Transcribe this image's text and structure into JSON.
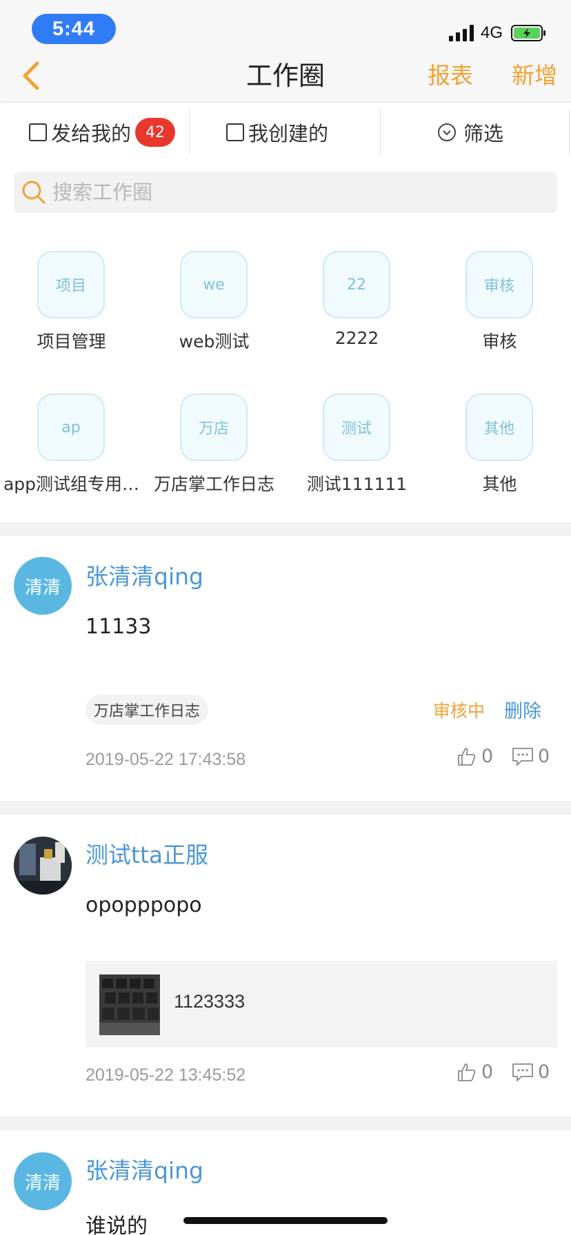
{
  "status_bar": {
    "time": "5:44",
    "network": "4G"
  },
  "nav": {
    "title": "工作圈",
    "report": "报表",
    "add": "新增"
  },
  "filters": {
    "sent_to_me": "发给我的",
    "sent_to_me_count": "42",
    "created_by_me": "我创建的",
    "filter": "筛选"
  },
  "search": {
    "placeholder": "搜索工作圈"
  },
  "categories": [
    {
      "icon_text": "项目",
      "label": "项目管理"
    },
    {
      "icon_text": "we",
      "label": "web测试"
    },
    {
      "icon_text": "22",
      "label": "2222"
    },
    {
      "icon_text": "审核",
      "label": "审核"
    },
    {
      "icon_text": "ap",
      "label": "app测试组专用…"
    },
    {
      "icon_text": "万店",
      "label": "万店掌工作日志"
    },
    {
      "icon_text": "测试",
      "label": "测试111111"
    },
    {
      "icon_text": "其他",
      "label": "其他"
    }
  ],
  "posts": [
    {
      "avatar_text": "清清",
      "author": "张清清qing",
      "content": "11133",
      "tag": "万店掌工作日志",
      "status": "审核中",
      "delete": "删除",
      "time": "2019-05-22 17:43:58",
      "likes": "0",
      "comments": "0"
    },
    {
      "author": "测试tta正服",
      "content": "opopppopo",
      "attachment_text": "1123333",
      "time": "2019-05-22 13:45:52",
      "likes": "0",
      "comments": "0"
    },
    {
      "avatar_text": "清清",
      "author": "张清清qing",
      "content": "谁说的"
    }
  ],
  "colors": {
    "accent": "#f0a232",
    "link": "#4a97d6",
    "badge": "#e8382c",
    "avatar": "#5ab7e2"
  }
}
